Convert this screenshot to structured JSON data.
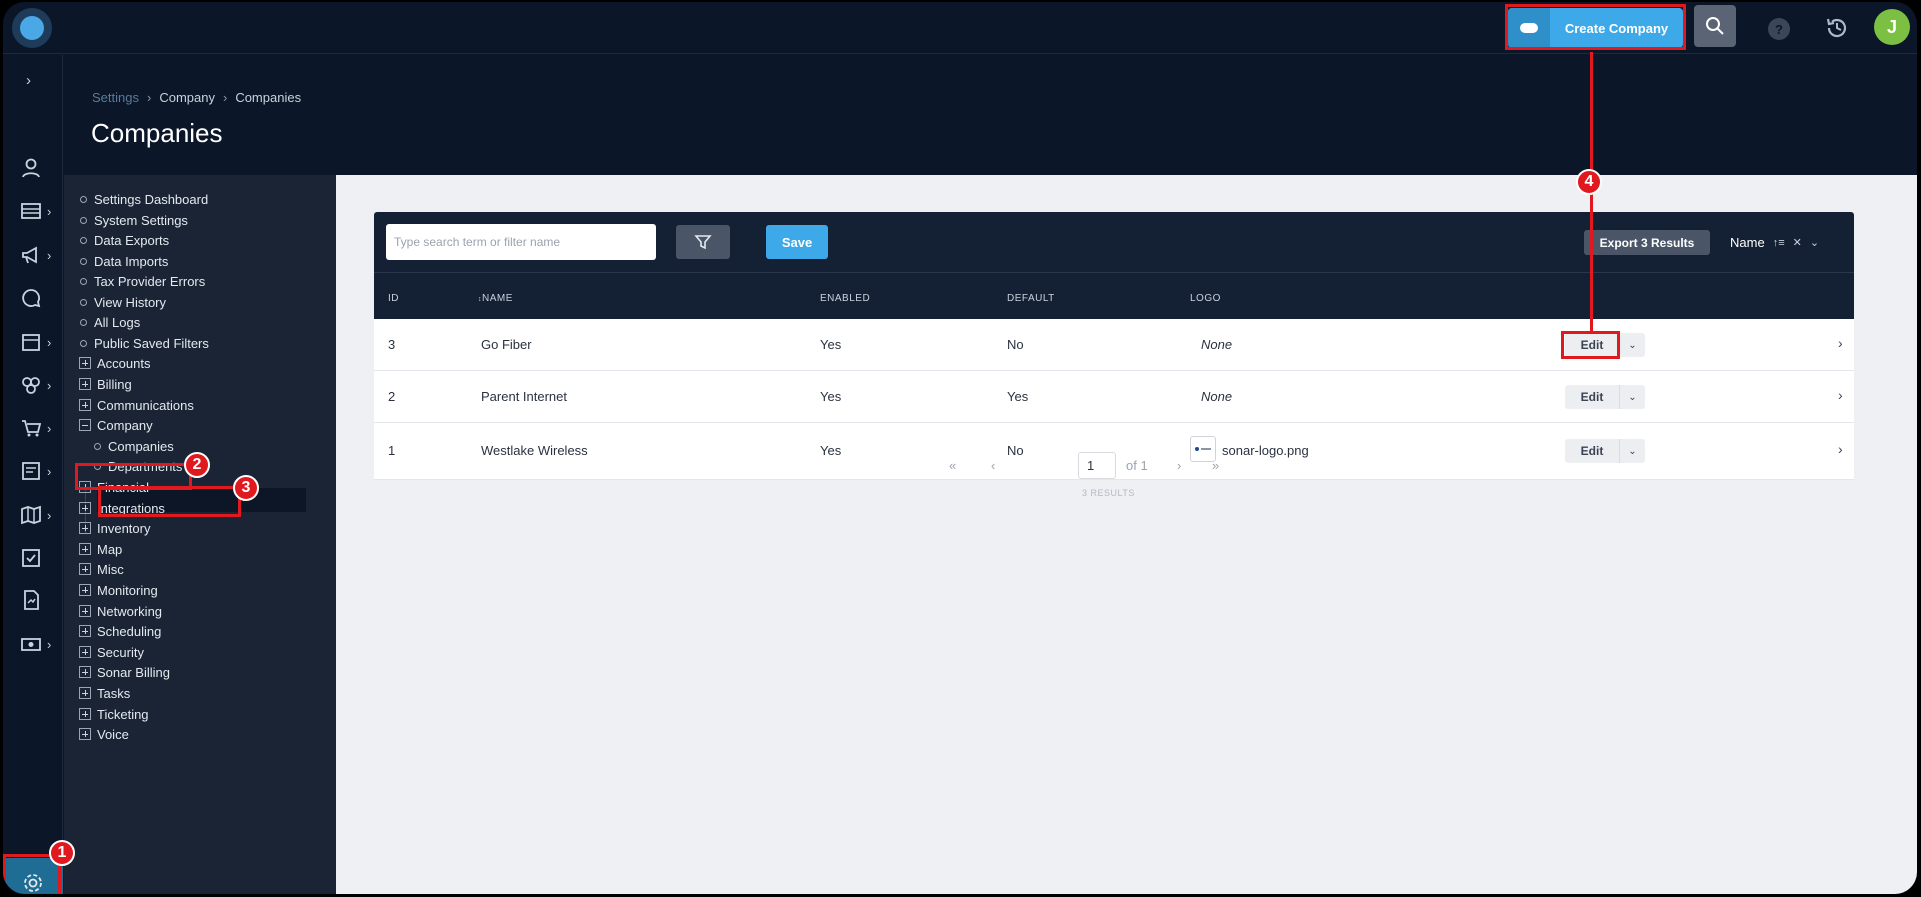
{
  "topbar": {
    "create_button_label": "Create Company",
    "help_label": "?",
    "avatar_initial": "J"
  },
  "rail": {
    "items": [
      "expand",
      "contacts",
      "accounting",
      "announcements",
      "messages",
      "calendar",
      "network",
      "orders",
      "reports",
      "map",
      "tasks",
      "documents",
      "billing"
    ],
    "settings": "settings"
  },
  "breadcrumb": {
    "first": "Settings",
    "second": "Company",
    "third": "Companies",
    "sep": "›"
  },
  "page": {
    "title": "Companies"
  },
  "subnav": {
    "items": [
      {
        "label": "Settings Dashboard",
        "type": "leaf"
      },
      {
        "label": "System Settings",
        "type": "leaf"
      },
      {
        "label": "Data Exports",
        "type": "leaf"
      },
      {
        "label": "Data Imports",
        "type": "leaf"
      },
      {
        "label": "Tax Provider Errors",
        "type": "leaf"
      },
      {
        "label": "View History",
        "type": "leaf"
      },
      {
        "label": "All Logs",
        "type": "leaf"
      },
      {
        "label": "Public Saved Filters",
        "type": "leaf"
      },
      {
        "label": "Accounts",
        "type": "group"
      },
      {
        "label": "Billing",
        "type": "group"
      },
      {
        "label": "Communications",
        "type": "group"
      },
      {
        "label": "Company",
        "type": "group-open"
      },
      {
        "label": "Companies",
        "type": "child-active"
      },
      {
        "label": "Departments",
        "type": "child"
      },
      {
        "label": "Financial",
        "type": "group"
      },
      {
        "label": "Integrations",
        "type": "group"
      },
      {
        "label": "Inventory",
        "type": "group"
      },
      {
        "label": "Map",
        "type": "group"
      },
      {
        "label": "Misc",
        "type": "group"
      },
      {
        "label": "Monitoring",
        "type": "group"
      },
      {
        "label": "Networking",
        "type": "group"
      },
      {
        "label": "Scheduling",
        "type": "group"
      },
      {
        "label": "Security",
        "type": "group"
      },
      {
        "label": "Sonar Billing",
        "type": "group"
      },
      {
        "label": "Tasks",
        "type": "group"
      },
      {
        "label": "Ticketing",
        "type": "group"
      },
      {
        "label": "Voice",
        "type": "group"
      }
    ]
  },
  "toolbar": {
    "search_placeholder": "Type search term or filter name",
    "save_label": "Save",
    "export_label": "Export 3 Results",
    "sort_label": "Name",
    "sort_dir_icon": "↑≡",
    "clear_icon": "✕",
    "caret_icon": "⌄"
  },
  "table": {
    "columns": [
      "ID",
      "NAME",
      "ENABLED",
      "DEFAULT",
      "LOGO"
    ],
    "name_sort_glyph": "↕",
    "edit_label": "Edit",
    "rows": [
      {
        "id": "3",
        "name": "Go Fiber",
        "enabled": "Yes",
        "default": "No",
        "logo": "None"
      },
      {
        "id": "2",
        "name": "Parent Internet",
        "enabled": "Yes",
        "default": "Yes",
        "logo": "None"
      },
      {
        "id": "1",
        "name": "Westlake Wireless",
        "enabled": "Yes",
        "default": "No",
        "logo": "sonar-logo.png"
      }
    ]
  },
  "pager": {
    "first": "«",
    "prev": "‹",
    "page": "1",
    "of": "of 1",
    "next": "›",
    "last": "»",
    "results": "3 RESULTS"
  },
  "annotations": {
    "badges": [
      "1",
      "2",
      "3",
      "4"
    ]
  },
  "colors": {
    "accent": "#3ea9e8",
    "highlight": "#e0191e",
    "navbg": "#1a2434",
    "topbg": "#0b1628"
  }
}
